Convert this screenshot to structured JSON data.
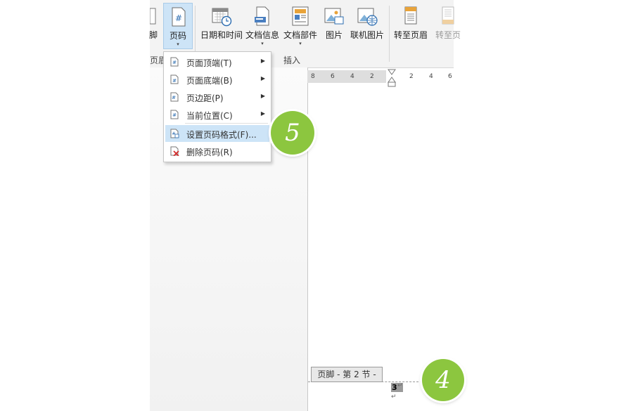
{
  "ribbon": {
    "partial_left_label": "脚",
    "page_number_label": "页码",
    "date_time_label": "日期和时间",
    "doc_info_label": "文档信息",
    "doc_parts_label": "文档部件",
    "picture_label": "图片",
    "online_picture_label": "联机图片",
    "goto_header_label": "转至页眉",
    "goto_footer_label": "转至页",
    "group_left_label": "页眉",
    "group_insert_label": "插入",
    "dropdown_arrow": "▾"
  },
  "ruler": {
    "ticks": [
      "8",
      "6",
      "4",
      "2",
      "2",
      "4",
      "6"
    ]
  },
  "menu": {
    "items": [
      {
        "label": "页面顶端(T)",
        "submenu_arrow": "▶"
      },
      {
        "label": "页面底端(B)",
        "submenu_arrow": "▶"
      },
      {
        "label": "页边距(P)",
        "submenu_arrow": "▶"
      },
      {
        "label": "当前位置(C)",
        "submenu_arrow": "▶"
      },
      {
        "label": "设置页码格式(F)..."
      },
      {
        "label": "删除页码(R)"
      }
    ],
    "highlighted_index": 4
  },
  "badges": {
    "step5": "5",
    "step4": "4",
    "color": "#8cc63f"
  },
  "footer": {
    "tag": "页脚 - 第 2 节 -",
    "page_number": "3",
    "para_mark": "↵"
  },
  "colors": {
    "ribbon_bg": "#f3f3f3",
    "highlight": "#cde4f7",
    "accent_blue": "#2b6cb0"
  }
}
